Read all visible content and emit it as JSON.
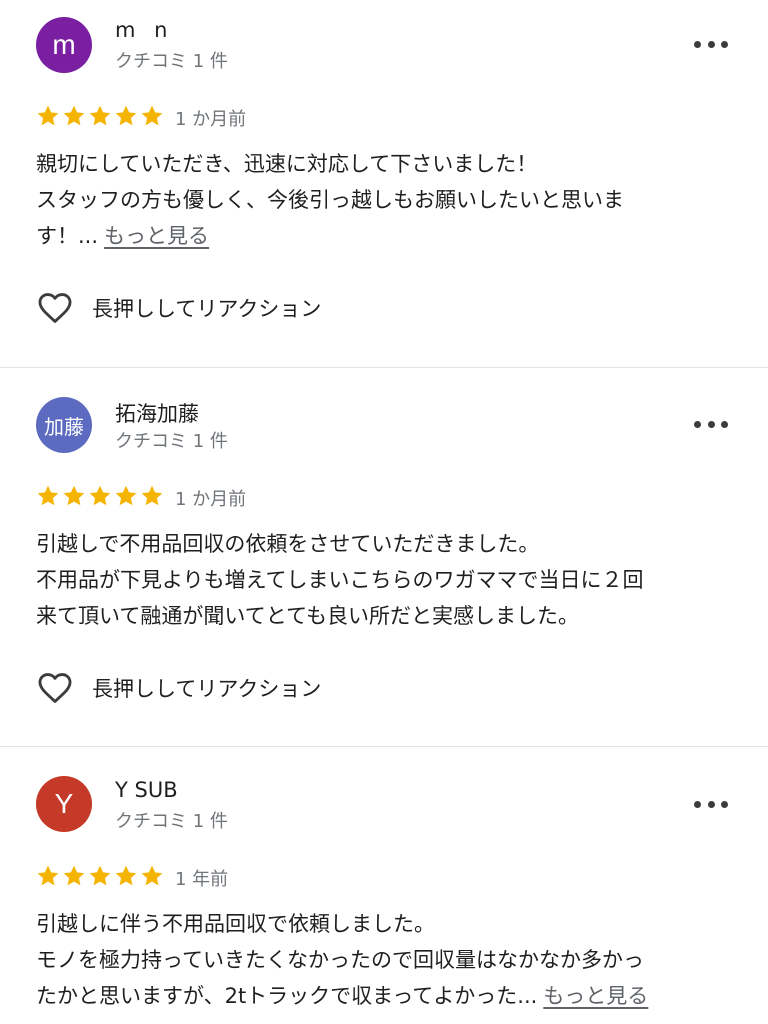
{
  "colors": {
    "star": "#f4b400",
    "secondary_text": "#70757a",
    "link": "#5f6368"
  },
  "reviews": [
    {
      "avatar": {
        "text": "m",
        "bg": "#7b1fa2"
      },
      "name": "m n",
      "meta": "クチコミ 1 件",
      "rating": 5,
      "date": "1 か月前",
      "text_lines": [
        "親切にしていただき、迅速に対応して下さいました！",
        "スタッフの方も優しく、今後引っ越しもお願いしたいと思いま",
        "す！..."
      ],
      "more_link": "もっと見る",
      "reaction_label": "長押ししてリアクション",
      "menu_icon": "more-horiz-icon"
    },
    {
      "avatar": {
        "text": "加藤",
        "bg": "#5c6bc0"
      },
      "name": "拓海加藤",
      "meta": "クチコミ 1 件",
      "rating": 5,
      "date": "1 か月前",
      "text_lines": [
        "引越しで不用品回収の依頼をさせていただきました。",
        "不用品が下見よりも増えてしまいこちらのワガママで当日に２回",
        "来て頂いて融通が聞いてとても良い所だと実感しました。"
      ],
      "reaction_label": "長押ししてリアクション",
      "menu_icon": "more-horiz-icon"
    },
    {
      "avatar": {
        "text": "Y",
        "bg": "#c53929"
      },
      "name": "Y SUB",
      "meta": "クチコミ 1 件",
      "rating": 5,
      "date": "1 年前",
      "text_lines": [
        "引越しに伴う不用品回収で依頼しました。",
        "モノを極力持っていきたくなかったので回収量はなかなか多かっ",
        "たかと思いますが、2tトラックで収まってよかった..."
      ],
      "more_link": "もっと見る",
      "menu_icon": "more-horiz-icon"
    }
  ]
}
